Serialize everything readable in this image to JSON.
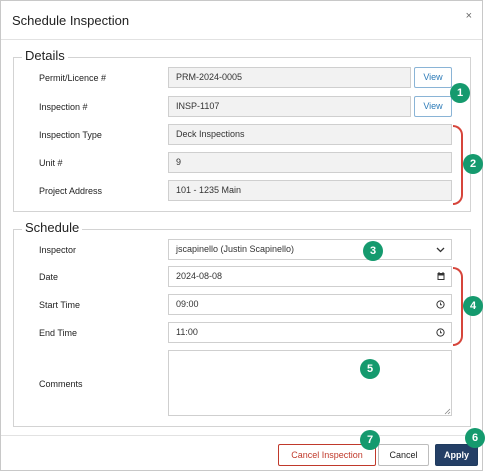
{
  "dialog": {
    "title": "Schedule Inspection",
    "close_glyph": "×"
  },
  "details": {
    "legend": "Details",
    "permit_label": "Permit/Licence #",
    "permit_value": "PRM-2024-0005",
    "inspection_label": "Inspection #",
    "inspection_value": "INSP-1107",
    "type_label": "Inspection Type",
    "type_value": "Deck Inspections",
    "unit_label": "Unit #",
    "unit_value": "9",
    "address_label": "Project Address",
    "address_value": "101 - 1235 Main",
    "view_label": "View"
  },
  "schedule": {
    "legend": "Schedule",
    "inspector_label": "Inspector",
    "inspector_value": "jscapinello (Justin Scapinello)",
    "date_label": "Date",
    "date_value": "2024-08-08",
    "start_label": "Start Time",
    "start_value": "09:00",
    "end_label": "End Time",
    "end_value": "11:00",
    "comments_label": "Comments",
    "comments_value": ""
  },
  "footer": {
    "cancel_inspection_label": "Cancel Inspection",
    "cancel_label": "Cancel",
    "apply_label": "Apply"
  },
  "badges": [
    "1",
    "2",
    "3",
    "4",
    "5",
    "6",
    "7"
  ],
  "colors": {
    "badge": "#159a6e",
    "bracket": "#d6453b",
    "apply_bg": "#243f66",
    "view_text": "#2d7bb8",
    "danger": "#c0392b"
  },
  "icons": {
    "dropdown": "chevron-down-icon",
    "date": "calendar-icon",
    "time": "clock-icon",
    "close": "close-icon"
  }
}
